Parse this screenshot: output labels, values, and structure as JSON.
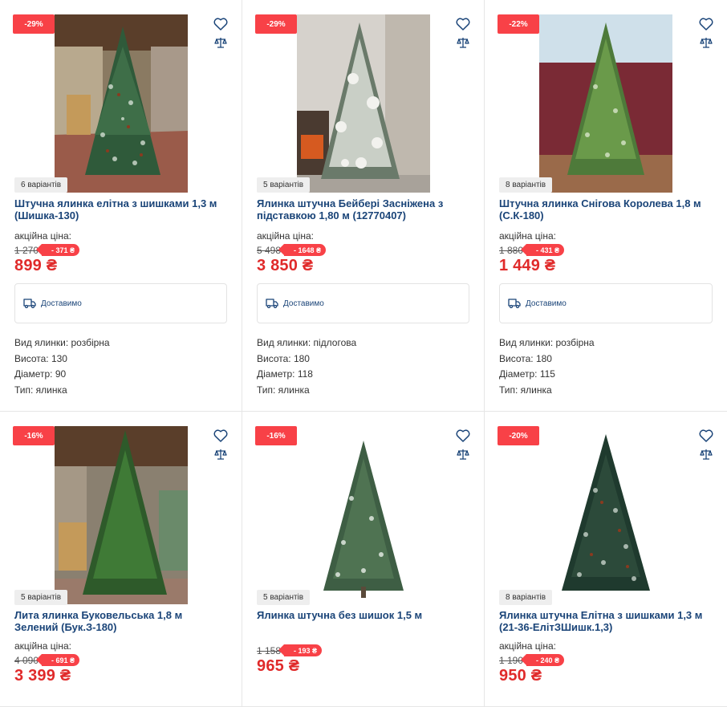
{
  "currency": "₴",
  "promo_label": "акційна ціна:",
  "delivery_label": "Доставимо",
  "products": [
    {
      "discount": "-29%",
      "variants": "6 варіантів",
      "title": "Штучна ялинка елітна з шишками 1,3 м (Шишка-130)",
      "old_price": "1 270",
      "save": "- 371 ₴",
      "price": "899 ₴",
      "specs": [
        "Вид ялинки: розбірна",
        "Висота: 130",
        "Діаметр: 90",
        "Тип: ялинка"
      ]
    },
    {
      "discount": "-29%",
      "variants": "5 варіантів",
      "title": "Ялинка штучна Бейбері Засніжена з підставкою 1,80 м (12770407)",
      "old_price": "5 498",
      "save": "- 1648 ₴",
      "price": "3 850 ₴",
      "specs": [
        "Вид ялинки: підлогова",
        "Висота: 180",
        "Діаметр: 118",
        "Тип: ялинка"
      ]
    },
    {
      "discount": "-22%",
      "variants": "8 варіантів",
      "title": "Штучна ялинка Снігова Королева 1,8 м (С.К-180)",
      "old_price": "1 880",
      "save": "- 431 ₴",
      "price": "1 449 ₴",
      "specs": [
        "Вид ялинки: розбірна",
        "Висота: 180",
        "Діаметр: 115",
        "Тип: ялинка"
      ]
    },
    {
      "discount": "-16%",
      "variants": "5 варіантів",
      "title": "Лита ялинка Буковельська 1,8 м Зелений (Бук.З-180)",
      "old_price": "4 090",
      "save": "- 691 ₴",
      "price": "3 399 ₴"
    },
    {
      "discount": "-16%",
      "variants": "5 варіантів",
      "title": "Ялинка штучна без шишок 1,5 м",
      "old_price": "1 158",
      "save": "- 193 ₴",
      "price": "965 ₴"
    },
    {
      "discount": "-20%",
      "variants": "8 варіантів",
      "title": "Ялинка штучна Елітна з шишками 1,3 м (21-36-ЕлітЗШишк.1,3)",
      "old_price": "1 190",
      "save": "- 240 ₴",
      "price": "950 ₴"
    }
  ],
  "icons": {
    "wishlist": "heart-icon",
    "compare": "scales-icon",
    "delivery": "truck-icon"
  },
  "colors": {
    "accent_red": "#f84147",
    "price_red": "#e02a2a",
    "title_blue": "#1a4478"
  }
}
